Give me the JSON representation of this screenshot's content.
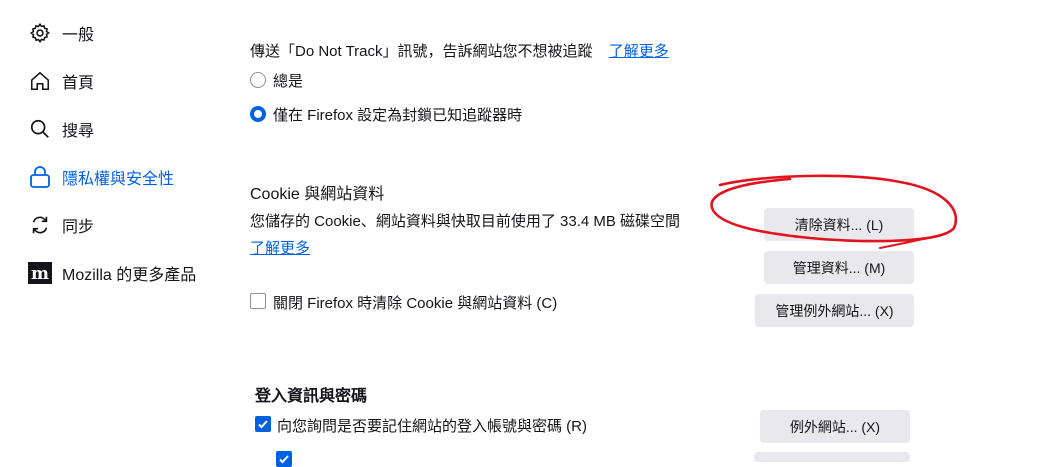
{
  "sidebar": {
    "items": [
      {
        "label": "一般",
        "icon": "gear-icon"
      },
      {
        "label": "首頁",
        "icon": "home-icon"
      },
      {
        "label": "搜尋",
        "icon": "search-icon"
      },
      {
        "label": "隱私權與安全性",
        "icon": "lock-icon",
        "active": true
      },
      {
        "label": "同步",
        "icon": "sync-icon"
      },
      {
        "label": "Mozilla 的更多產品",
        "icon": "mozilla-icon"
      }
    ]
  },
  "dnt": {
    "description": "傳送「Do Not Track」訊號，告訴網站您不想被追蹤",
    "learn_more": "了解更多",
    "options": [
      {
        "label": "總是",
        "checked": false
      },
      {
        "label": "僅在 Firefox 設定為封鎖已知追蹤器時",
        "checked": true
      }
    ]
  },
  "cookies": {
    "title": "Cookie 與網站資料",
    "usage": "您儲存的 Cookie、網站資料與快取目前使用了 33.4 MB 磁碟空間",
    "learn_more": "了解更多",
    "clear_on_close": {
      "label": "關閉 Firefox 時清除 Cookie 與網站資料 (C)",
      "checked": false
    },
    "buttons": {
      "clear": "清除資料... (L)",
      "manage": "管理資料... (M)",
      "exceptions": "管理例外網站... (X)"
    }
  },
  "logins": {
    "title": "登入資訊與密碼",
    "ask_save": {
      "label": "向您詢問是否要記住網站的登入帳號與密碼 (R)",
      "checked": true
    },
    "exceptions_button": "例外網站... (X)"
  },
  "annotation_color": "#e0141e",
  "accent_color": "#0061e0"
}
